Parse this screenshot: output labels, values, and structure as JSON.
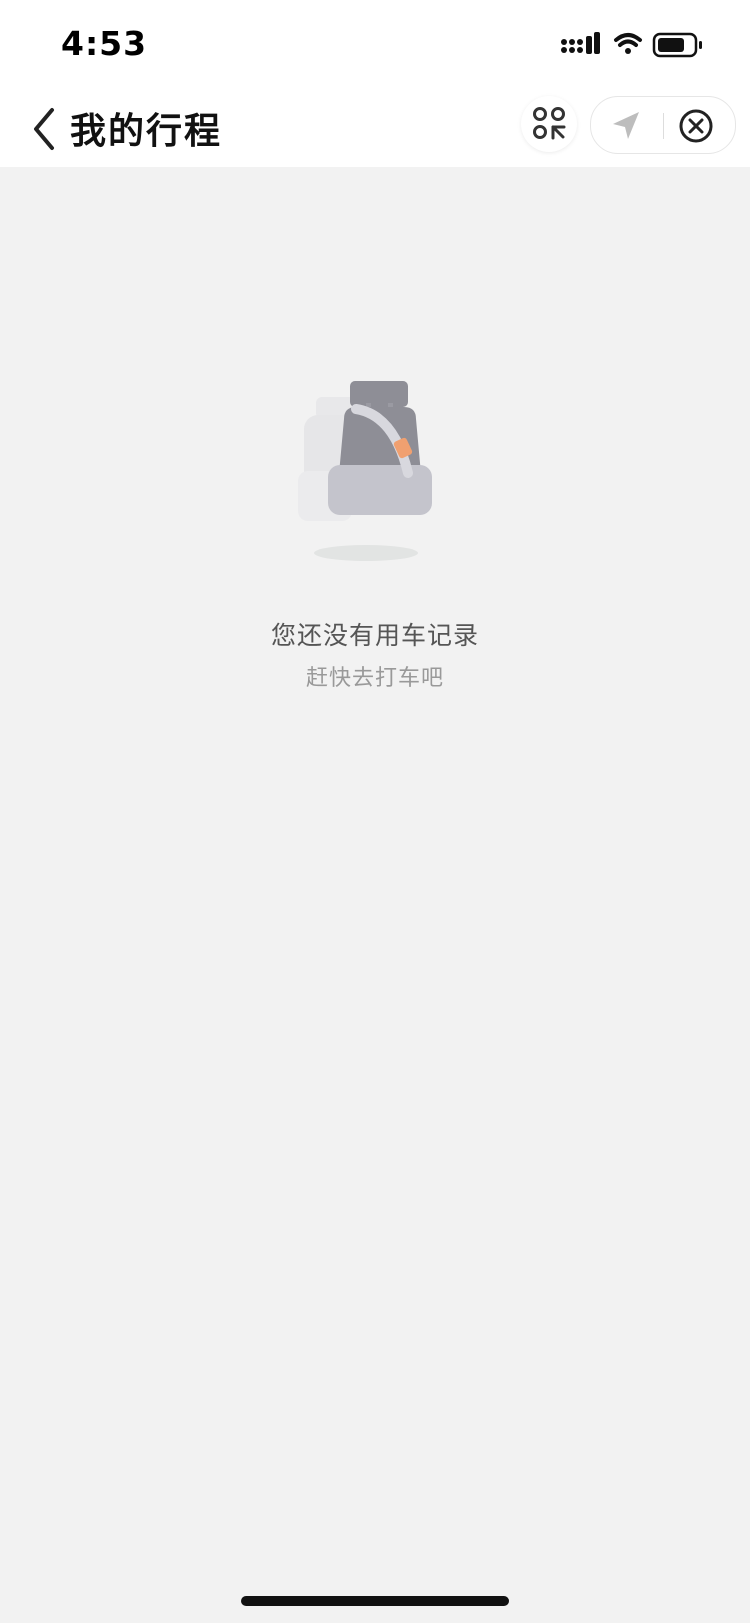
{
  "status_bar": {
    "time": "4:53"
  },
  "nav": {
    "title": "我的行程",
    "icons": [
      "back-chevron-icon",
      "scan-icon",
      "location-arrow-icon",
      "close-circle-icon"
    ]
  },
  "empty_state": {
    "title": "您还没有用车记录",
    "subtitle": "赶快去打车吧"
  },
  "colors": {
    "background": "#f2f2f2",
    "header": "#ffffff",
    "accent_orange": "#f0a070",
    "seat_gray": "#8e8e96"
  }
}
